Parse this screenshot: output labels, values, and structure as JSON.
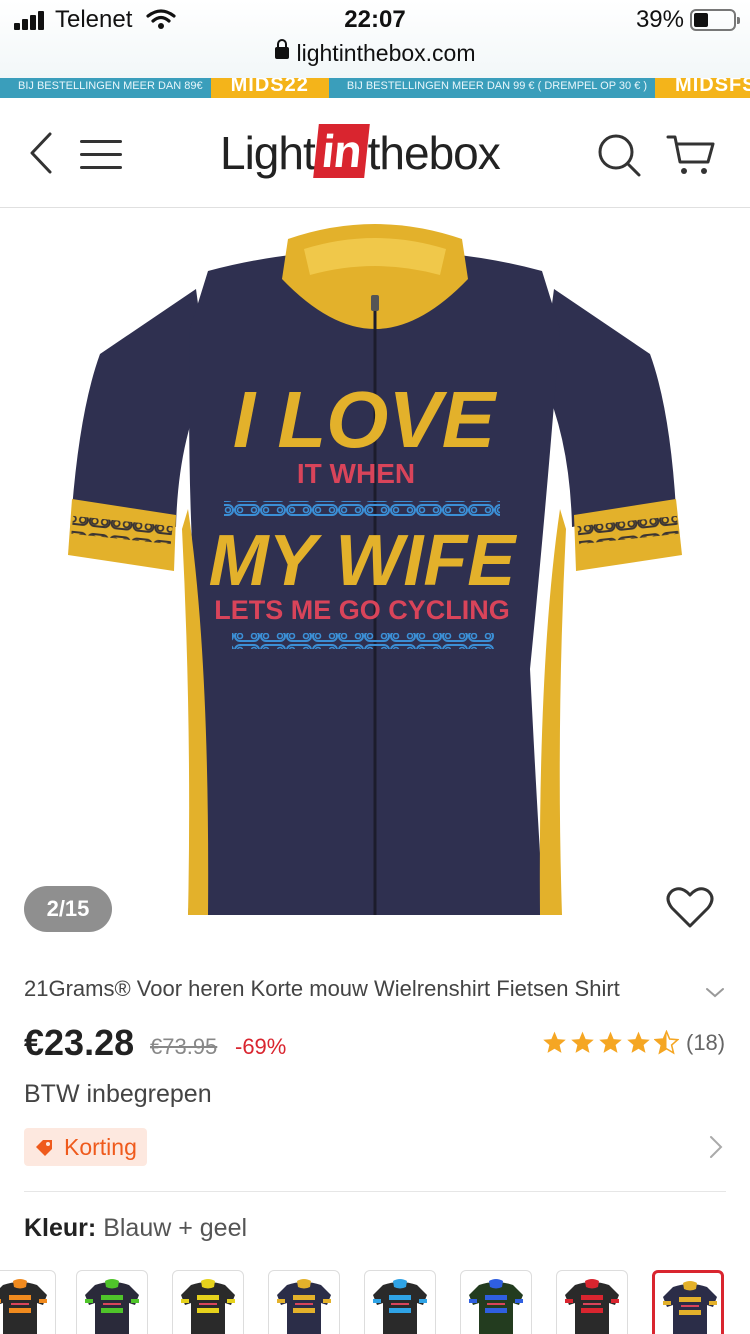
{
  "status_bar": {
    "carrier": "Telenet",
    "time": "22:07",
    "battery": "39%",
    "url": "lightinthebox.com"
  },
  "promo": {
    "text1": "BIJ BESTELLINGEN MEER DAN 89€",
    "code1": "MIDS22",
    "text2": "BIJ BESTELLINGEN MEER DAN 99 € ( DREMPEL OP 30 € )",
    "code2": "MIDSFS"
  },
  "header": {
    "logo_part1": "Light",
    "logo_part2": "in",
    "logo_part3": "thebox"
  },
  "product": {
    "image_print": {
      "line1": "I LOVE",
      "line2": "IT WHEN",
      "line3": "MY WIFE",
      "line4": "LETS ME GO CYCLING"
    },
    "counter": "2/15",
    "title": "21Grams® Voor heren Korte mouw Wielrenshirt Fietsen Shirt",
    "price": "€23.28",
    "old_price": "€73.95",
    "discount": "-69%",
    "rating": 4.5,
    "review_count": "(18)",
    "vat_note": "BTW inbegrepen",
    "korting_label": "Korting",
    "color_label": "Kleur:",
    "color_value": "Blauw + geel"
  },
  "swatches": [
    {
      "accent": "#f08a1e",
      "body": "#2a2a2a",
      "selected": false
    },
    {
      "accent": "#4fc42a",
      "body": "#2a2a3a",
      "selected": false
    },
    {
      "accent": "#e6d21c",
      "body": "#2a2a2a",
      "selected": false
    },
    {
      "accent": "#e3b12b",
      "body": "#2b2d48",
      "selected": false
    },
    {
      "accent": "#2fa3e6",
      "body": "#2a2a2a",
      "selected": false
    },
    {
      "accent": "#2f5fe0",
      "body": "#233c1f",
      "selected": false
    },
    {
      "accent": "#d9252f",
      "body": "#2a2a2a",
      "selected": false
    },
    {
      "accent": "#e3b12b",
      "body": "#2b2d48",
      "selected": true
    }
  ],
  "colors": {
    "brand_red": "#d9252f",
    "star": "#f5a623",
    "korting_text": "#ef5a1c",
    "jersey_body": "#2f3050",
    "jersey_accent": "#e3b12b"
  }
}
